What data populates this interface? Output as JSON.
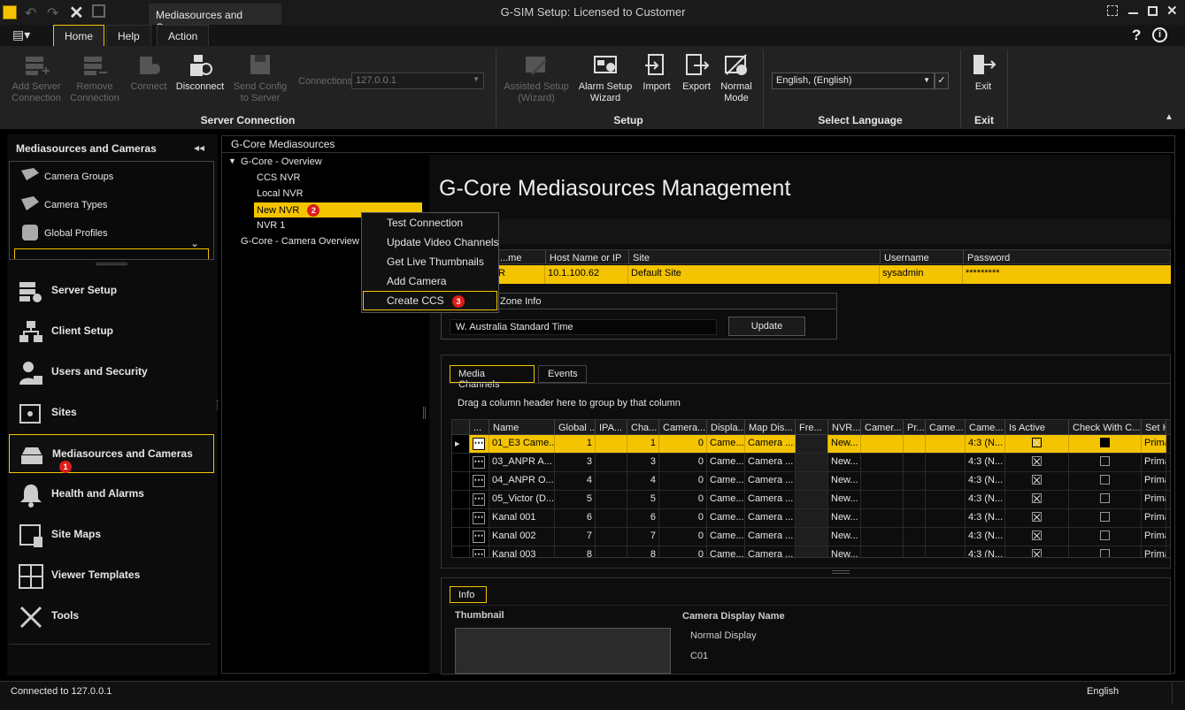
{
  "window": {
    "doc_tab": "Mediasources and Cameras",
    "title": "G-SIM Setup: Licensed to Customer"
  },
  "menu": {
    "tabs": [
      "Home",
      "Help",
      "Action"
    ]
  },
  "ribbon": {
    "buttons": [
      {
        "label": "Add Server Connection",
        "line1": "Add Server",
        "line2": "Connection",
        "enabled": false,
        "icon": "add-server-icon"
      },
      {
        "label": "Remove Connection",
        "line1": "Remove",
        "line2": "Connection",
        "enabled": false,
        "icon": "remove-server-icon"
      },
      {
        "label": "Connect",
        "line1": "Connect",
        "line2": "",
        "enabled": false,
        "icon": "connect-icon"
      },
      {
        "label": "Disconnect",
        "line1": "Disconnect",
        "line2": "",
        "enabled": true,
        "icon": "disconnect-icon"
      },
      {
        "label": "Send Config to Server",
        "line1": "Send Config",
        "line2": "to Server",
        "enabled": false,
        "icon": "save-icon"
      }
    ],
    "connections_label": "Connections",
    "connections_value": "127.0.0.1",
    "server_connection_group": "Server Connection",
    "setup_buttons": [
      {
        "line1": "Assisted Setup",
        "line2": "(Wizard)",
        "enabled": false,
        "icon": "wizard-icon"
      },
      {
        "line1": "Alarm Setup",
        "line2": "Wizard",
        "enabled": true,
        "icon": "alarm-wizard-icon"
      },
      {
        "line1": "Import",
        "line2": "",
        "enabled": true,
        "icon": "import-icon"
      },
      {
        "line1": "Export",
        "line2": "",
        "enabled": true,
        "icon": "export-icon"
      },
      {
        "line1": "Normal",
        "line2": "Mode",
        "enabled": true,
        "icon": "normal-mode-icon"
      }
    ],
    "setup_group": "Setup",
    "language_value": "English, (English)",
    "language_group": "Select Language",
    "exit_label": "Exit",
    "exit_group": "Exit"
  },
  "left": {
    "title": "Mediasources and Cameras",
    "sub_items": [
      "Camera Groups",
      "Camera Types",
      "Global Profiles"
    ],
    "nav": [
      {
        "label": "Server Setup",
        "icon": "server-setup-icon"
      },
      {
        "label": "Client Setup",
        "icon": "client-setup-icon"
      },
      {
        "label": "Users and Security",
        "icon": "users-security-icon"
      },
      {
        "label": "Sites",
        "icon": "sites-icon"
      },
      {
        "label": "Mediasources and Cameras",
        "icon": "mediasources-icon",
        "badge": "1"
      },
      {
        "label": "Health and Alarms",
        "icon": "bell-icon"
      },
      {
        "label": "Site Maps",
        "icon": "site-maps-icon"
      },
      {
        "label": "Viewer Templates",
        "icon": "viewer-templates-icon"
      },
      {
        "label": "Tools",
        "icon": "tools-icon"
      }
    ]
  },
  "tree": {
    "header": "G-Core Mediasources",
    "root": "G-Core - Overview",
    "children": [
      "CCS NVR",
      "Local NVR",
      "New NVR",
      "NVR 1"
    ],
    "selected_badge": "2",
    "camera_overview": "G-Core - Camera Overview"
  },
  "context_menu": {
    "items": [
      "Test Connection",
      "Update Video Channels",
      "Get Live Thumbnails",
      "Add Camera",
      "Create CCS"
    ],
    "badge": "3"
  },
  "content": {
    "title": "G-Core Mediasources Management",
    "server_headers": [
      "...me",
      "Host Name or IP",
      "Site",
      "Username",
      "Password"
    ],
    "server_row": [
      "R",
      "10.1.100.62",
      "Default Site",
      "sysadmin",
      "*********"
    ],
    "timezone_label": "Zone Info",
    "timezone_value": "W. Australia Standard Time",
    "update_button": "Update",
    "tabs": [
      "Media Channels",
      "Events"
    ],
    "group_hint": "Drag a column header here to group by that column",
    "grid_headers": [
      "...",
      "Name",
      "Global ...",
      "IPA...",
      "Cha...",
      "Camera...",
      "Displa...",
      "Map Dis...",
      "Fre...",
      "NVR...",
      "Camer...",
      "Pr...",
      "Came...",
      "Came...",
      "Is Active",
      "Check With C...",
      "Set H"
    ],
    "rows": [
      {
        "name": "01_E3 Came...",
        "global": "1",
        "cha": "1",
        "camera": "0",
        "displ": "Came...",
        "map": "Camera ...",
        "nvr": "New...",
        "came": "4:3 (N...",
        "active": true,
        "check": true,
        "set": "Prima"
      },
      {
        "name": "03_ANPR A...",
        "global": "3",
        "cha": "3",
        "camera": "0",
        "displ": "Came...",
        "map": "Camera ...",
        "nvr": "New...",
        "came": "4:3 (N...",
        "active": true,
        "check": false,
        "set": "Prima"
      },
      {
        "name": "04_ANPR O...",
        "global": "4",
        "cha": "4",
        "camera": "0",
        "displ": "Came...",
        "map": "Camera ...",
        "nvr": "New...",
        "came": "4:3 (N...",
        "active": true,
        "check": false,
        "set": "Prima"
      },
      {
        "name": "05_Victor (D...",
        "global": "5",
        "cha": "5",
        "camera": "0",
        "displ": "Came...",
        "map": "Camera ...",
        "nvr": "New...",
        "came": "4:3 (N...",
        "active": true,
        "check": false,
        "set": "Prima"
      },
      {
        "name": "Kanal 001",
        "global": "6",
        "cha": "6",
        "camera": "0",
        "displ": "Came...",
        "map": "Camera ...",
        "nvr": "New...",
        "came": "4:3 (N...",
        "active": true,
        "check": false,
        "set": "Prima"
      },
      {
        "name": "Kanal 002",
        "global": "7",
        "cha": "7",
        "camera": "0",
        "displ": "Came...",
        "map": "Camera ...",
        "nvr": "New...",
        "came": "4:3 (N...",
        "active": true,
        "check": false,
        "set": "Prima"
      },
      {
        "name": "Kanal 003",
        "global": "8",
        "cha": "8",
        "camera": "0",
        "displ": "Came...",
        "map": "Camera ...",
        "nvr": "New...",
        "came": "4:3 (N...",
        "active": true,
        "check": false,
        "set": "Prima"
      }
    ],
    "info_tab": "Info",
    "thumbnail_label": "Thumbnail",
    "display_name_label": "Camera Display Name",
    "display_name_line1": "Normal Display",
    "display_name_line2": "C01"
  },
  "status": {
    "left": "Connected to 127.0.0.1",
    "right": "English"
  },
  "colors": {
    "accent": "#f5c400",
    "badge": "#e01b1b"
  }
}
